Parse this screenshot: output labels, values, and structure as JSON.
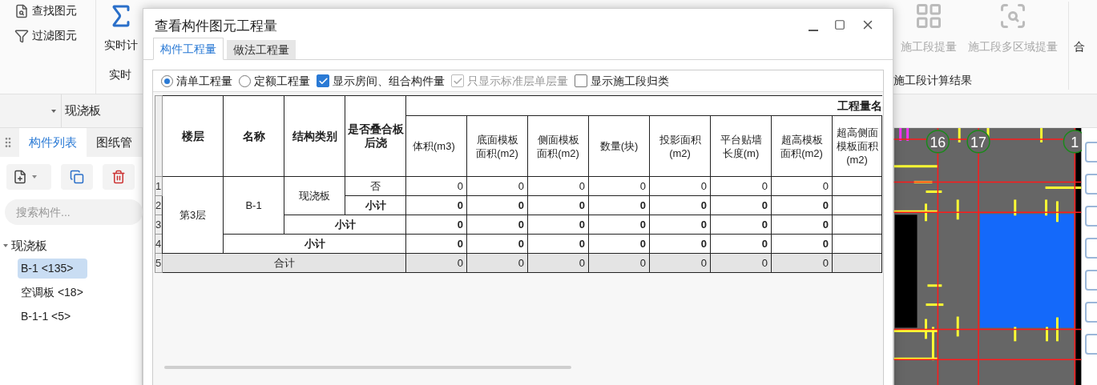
{
  "ribbon": {
    "left_items": [
      {
        "label": "查找图元"
      },
      {
        "label": "过滤图元"
      }
    ],
    "calc_button": {
      "label": "实时计"
    },
    "calc_group_label": "实时",
    "right_buttons": [
      {
        "label": "施工段提量"
      },
      {
        "label": "施工段多区域提量"
      },
      {
        "label": "合"
      }
    ],
    "right_group_label": "施工段计算结果"
  },
  "type_bar": {
    "value": "现浇板"
  },
  "left_panel": {
    "tabs": [
      {
        "label": "构件列表",
        "selected": true
      },
      {
        "label": "图纸管",
        "selected": false
      }
    ],
    "search": {
      "placeholder": "搜索构件..."
    },
    "tree": [
      {
        "label": "现浇板",
        "expanded": true,
        "children": [
          {
            "label": "B-1 <135>",
            "selected": true
          },
          {
            "label": "空调板 <18>",
            "selected": false
          },
          {
            "label": "B-1-1 <5>",
            "selected": false
          }
        ]
      }
    ]
  },
  "canvas": {
    "axis_labels": [
      "16",
      "17",
      "1"
    ]
  },
  "dialog": {
    "title": "查看构件图元工程量",
    "tabs": [
      {
        "label": "构件工程量",
        "selected": true
      },
      {
        "label": "做法工程量",
        "selected": false
      }
    ],
    "options": [
      {
        "kind": "radio",
        "label": "清单工程量",
        "selected": true
      },
      {
        "kind": "radio",
        "label": "定额工程量",
        "selected": false
      },
      {
        "kind": "checkbox",
        "label": "显示房间、组合构件量",
        "checked": true,
        "disabled": false
      },
      {
        "kind": "checkbox",
        "label": "只显示标准层单层量",
        "checked": true,
        "disabled": true
      },
      {
        "kind": "checkbox",
        "label": "显示施工段归类",
        "checked": false,
        "disabled": false
      }
    ],
    "table": {
      "key_columns": [
        "楼层",
        "名称",
        "结构类别",
        "是否叠合板后浇"
      ],
      "group_header": "工程量名",
      "value_columns": [
        "体积(m3)",
        "底面模板面积(m2)",
        "侧面模板面积(m2)",
        "数量(块)",
        "投影面积(m2)",
        "平台贴墙长度(m)",
        "超高模板面积(m2)",
        "超高侧面模板面积(m2)"
      ],
      "rows": [
        {
          "no": "1",
          "kind": "detail",
          "floor": "第3层",
          "name": "B-1",
          "type": "现浇板",
          "label": "否",
          "values": [
            "0",
            "0",
            "0",
            "0",
            "0",
            "0",
            "0"
          ]
        },
        {
          "no": "2",
          "kind": "type_subtotal",
          "label": "小计",
          "values": [
            "0",
            "0",
            "0",
            "0",
            "0",
            "0",
            "0"
          ]
        },
        {
          "no": "3",
          "kind": "name_subtotal",
          "label": "小计",
          "values": [
            "0",
            "0",
            "0",
            "0",
            "0",
            "0",
            "0"
          ]
        },
        {
          "no": "4",
          "kind": "floor_subtotal",
          "label": "小计",
          "values": [
            "0",
            "0",
            "0",
            "0",
            "0",
            "0",
            "0"
          ]
        },
        {
          "no": "5",
          "kind": "total",
          "label": "合计",
          "values": [
            "0",
            "0",
            "0",
            "0",
            "0",
            "0",
            "0"
          ]
        }
      ]
    }
  }
}
